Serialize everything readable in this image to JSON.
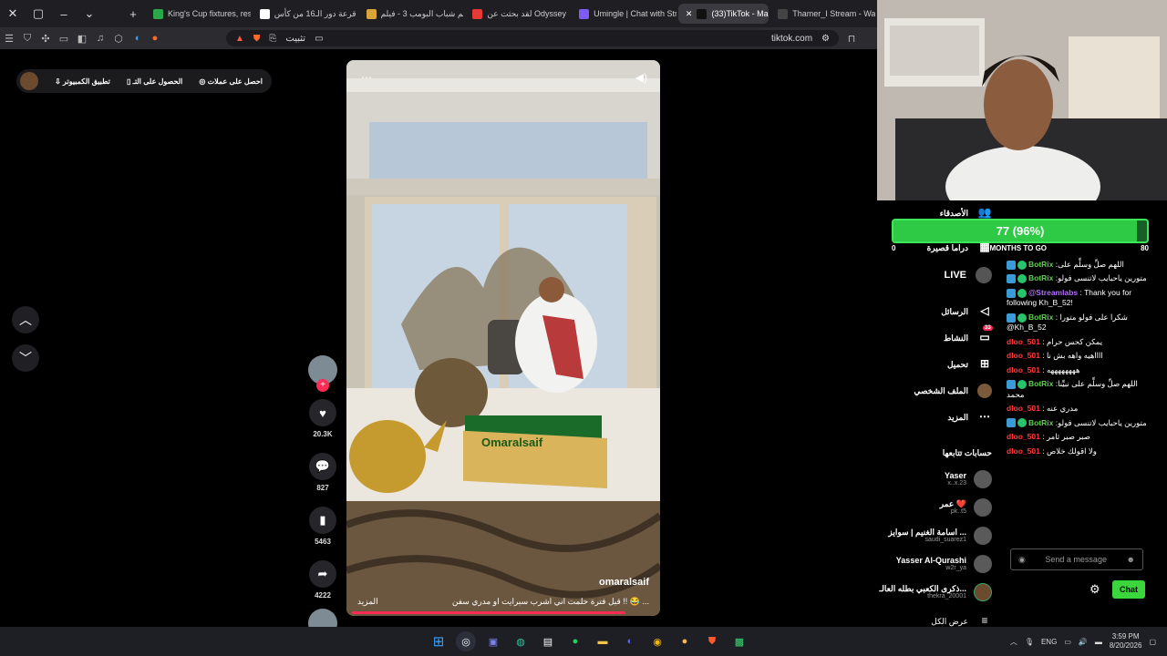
{
  "browser": {
    "tabs": [
      {
        "title": "King's Cup fixtures, resu",
        "color": "#2aa84a"
      },
      {
        "title": "قرعة دور الـ16 من كأس",
        "color": "#ffffff"
      },
      {
        "title": "فيلم شباب البومب 3 - فيلم",
        "color": "#d9a43a"
      },
      {
        "title": "لقد بحثت عن Odyssey",
        "color": "#e53935"
      },
      {
        "title": "Umingle | Chat with Stra",
        "color": "#7c5cf2"
      },
      {
        "title": "(33)TikTok - Mak",
        "color": "#111111",
        "active": true
      },
      {
        "title": "Thamer_I Stream - Wat",
        "color": "#444"
      }
    ],
    "address": {
      "install": "تثبيت",
      "url": "tiktok.com"
    }
  },
  "tiktok": {
    "top_buttons": [
      "احصل على عملات",
      "الحصول على التـ",
      "تطبيق الكمبيوتر"
    ],
    "video": {
      "username": "omaralsaif",
      "caption": "قبل فترة حلمت اني اشرب سبرايت او مدري سفن !! 😂 ...",
      "more": "المزيد",
      "crate_text": "Omaralsaif"
    },
    "actions": {
      "likes": "20.3K",
      "comments": "827",
      "saves": "5463",
      "shares": "4222"
    },
    "nav": [
      {
        "label": "الأصدقاء",
        "icon": "friends-icon"
      },
      {
        "label": "دراما قصيرة",
        "icon": "drama-icon"
      },
      {
        "label": "LIVE",
        "icon": "live-icon"
      },
      {
        "label": "الرسائل",
        "icon": "messages-icon"
      },
      {
        "label": "النشاط",
        "icon": "activity-icon",
        "badge": "33"
      },
      {
        "label": "تحميل",
        "icon": "upload-icon"
      },
      {
        "label": "الملف الشخصي",
        "icon": "profile-icon"
      },
      {
        "label": "المزيد",
        "icon": "more-icon"
      }
    ],
    "following_title": "حسابات تتابعها",
    "following": [
      {
        "name": "Yaser",
        "handle": "x..x.23"
      },
      {
        "name": "عمر ❤️",
        "handle": "pk..t5"
      },
      {
        "name": "اسامة الغنيم | سوايز ...",
        "handle": "saudi_suarez1"
      },
      {
        "name": "Yasser Al-Qurashi",
        "handle": "w2r_ya"
      },
      {
        "name": "ذكرى الكعبي بطله العالـ...",
        "handle": "thekra_20001"
      }
    ],
    "see_all": "عرض الكل"
  },
  "stream": {
    "goal": {
      "value": "77 (96%)",
      "fill": 0.96,
      "min": "0",
      "label": "MONTHS TO GO",
      "max": "80"
    },
    "chat": [
      {
        "user": "BotRix",
        "text": ":اللهم صلِّ وسلِّم على",
        "cls": "green",
        "bot": true
      },
      {
        "user": "BotRix",
        "text": ":متورين ياحبايب لاتنسى فولو",
        "cls": "green",
        "bot": true
      },
      {
        "user": "@Streamlabs",
        "text": ": Thank you for following Kh_B_52!",
        "cls": "purple",
        "bot": true
      },
      {
        "user": "BotRix",
        "text": ": شكرا على فولو متورا @Kh_B_52",
        "cls": "green",
        "bot": true
      },
      {
        "user": "dloo_501",
        "text": ": يمكن كحس حرام",
        "cls": "red"
      },
      {
        "user": "dloo_501",
        "text": ": ااااهيه واهه بش نا",
        "cls": "red"
      },
      {
        "user": "dloo_501",
        "text": ": ههههههههه",
        "cls": "red"
      },
      {
        "user": "BotRix",
        "text": ":اللهم صلِّ وسلِّم على نبيِّنا محمد",
        "cls": "green",
        "bot": true
      },
      {
        "user": "dloo_501",
        "text": ": مدري عنه",
        "cls": "red"
      },
      {
        "user": "BotRix",
        "text": ":متورين ياحبايب لاتنسى فولو",
        "cls": "green",
        "bot": true
      },
      {
        "user": "dloo_501",
        "text": ": صبر صبر ثامر",
        "cls": "red"
      },
      {
        "user": "dloo_501",
        "text": ": ولا اقولك خلاص",
        "cls": "red"
      }
    ],
    "placeholder": "Send a message",
    "chat_button": "Chat"
  },
  "taskbar": {
    "lang": "ENG",
    "time": "3:59 PM",
    "date": "8/20/2026"
  }
}
